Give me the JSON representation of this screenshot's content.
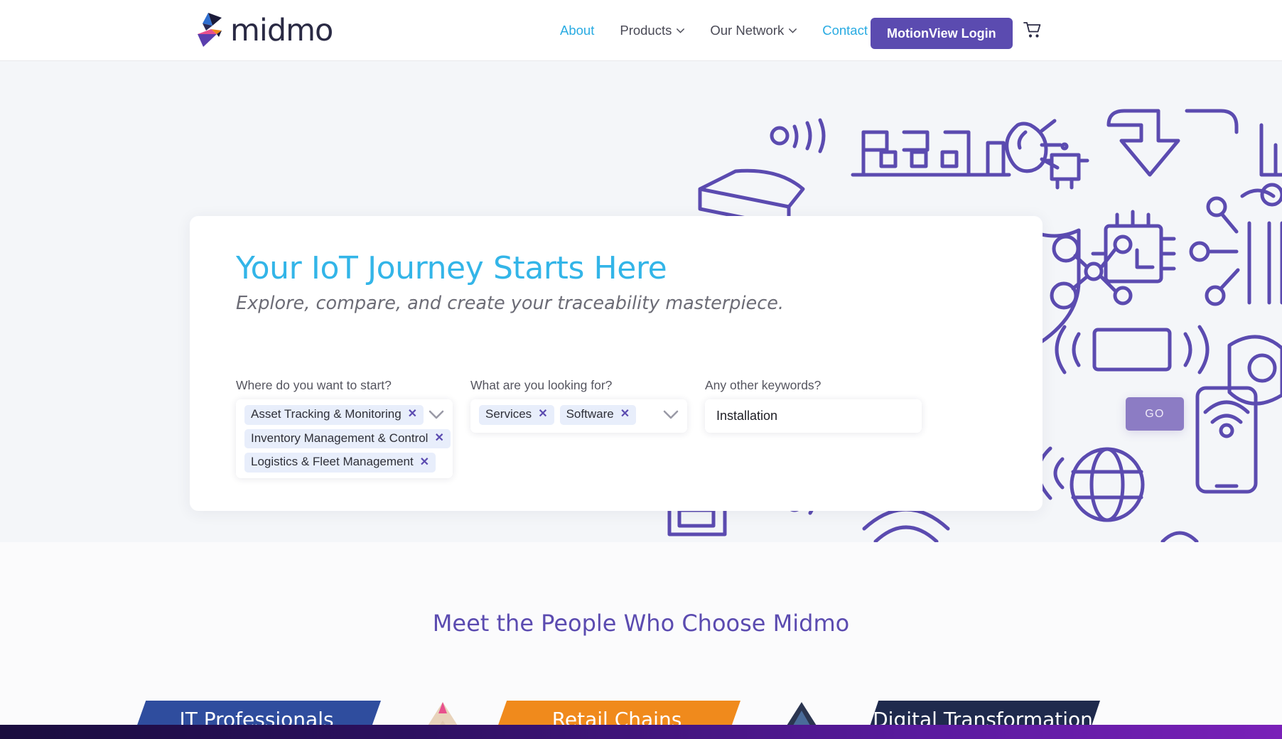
{
  "header": {
    "logo_text": "midmo",
    "logo_icon": "midmo-logo-mark",
    "nav": [
      {
        "label": "About",
        "style": "accent",
        "has_chevron": false
      },
      {
        "label": "Products",
        "style": "dark",
        "has_chevron": true
      },
      {
        "label": "Our Network",
        "style": "dark",
        "has_chevron": true
      },
      {
        "label": "Contact",
        "style": "accent",
        "has_chevron": false
      }
    ],
    "login_label": "MotionView Login",
    "cart_icon": "shopping-cart-icon"
  },
  "hero": {
    "title": "Your IoT Journey Starts Here",
    "subtitle": "Explore, compare, and create your traceability masterpiece.",
    "search": {
      "fields": [
        {
          "label": "Where do you want to start?",
          "type": "multiselect",
          "tags": [
            "Asset Tracking & Monitoring",
            "Inventory Management & Control",
            "Logistics & Fleet Management"
          ],
          "remove_icon": "close-x-icon",
          "caret_icon": "chevron-down-icon"
        },
        {
          "label": "What are you looking for?",
          "type": "multiselect",
          "tags": [
            "Services",
            "Software"
          ],
          "remove_icon": "close-x-icon",
          "caret_icon": "chevron-down-icon"
        },
        {
          "label": "Any other keywords?",
          "type": "text",
          "value": "Installation",
          "placeholder": "Any other keywords?"
        }
      ],
      "submit_label": "GO"
    }
  },
  "lower": {
    "section_title": "Meet the People Who Choose Midmo",
    "banners": [
      {
        "label": "IT Professionals",
        "color": "#2f4d9e"
      },
      {
        "label": "Retail Chains",
        "color": "#f08a1c"
      },
      {
        "label": "Digital Transformation",
        "color": "#1f2a4d"
      }
    ]
  },
  "colors": {
    "accent_cyan": "#33b5e8",
    "brand_purple": "#5b4bb0",
    "hero_bg": "#f4f6f9",
    "tag_bg": "#e8eefb",
    "go_button": "#8c7cc4"
  }
}
